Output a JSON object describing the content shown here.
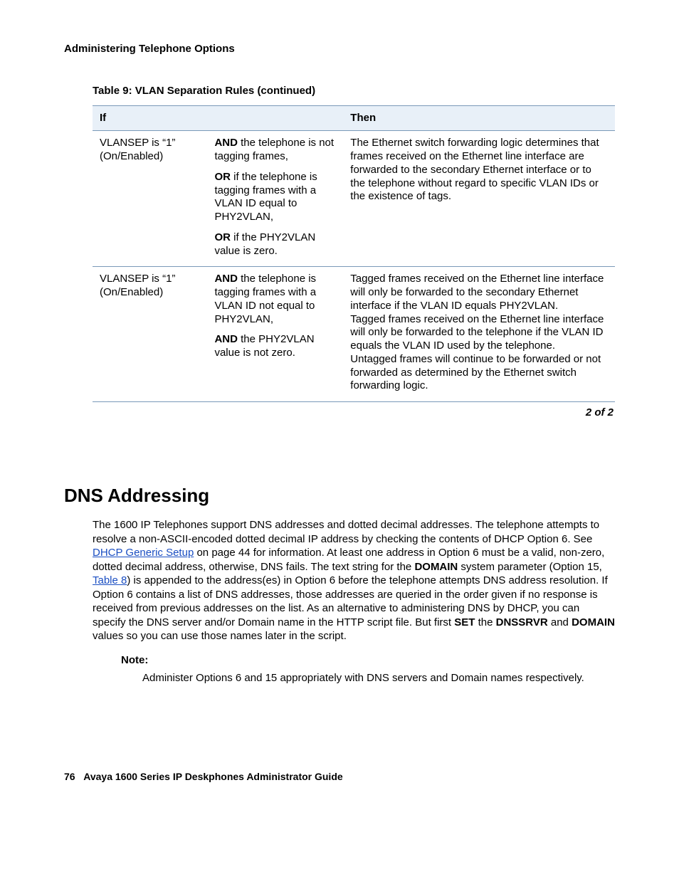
{
  "header": {
    "title": "Administering Telephone Options"
  },
  "table": {
    "caption": "Table 9: VLAN Separation Rules (continued)",
    "head_if": "If",
    "head_then": "Then",
    "rows": [
      {
        "if_text": "VLANSEP is “1” (On/Enabled)",
        "cond1_b": "AND",
        "cond1_t": " the telephone is not tagging frames,",
        "cond2_b": "OR",
        "cond2_t": " if the telephone is tagging frames with a VLAN ID equal to PHY2VLAN,",
        "cond3_b": "OR",
        "cond3_t": " if the PHY2VLAN value is zero.",
        "then": "The Ethernet switch forwarding logic determines that frames received on the Ethernet line interface are forwarded to the secondary Ethernet interface or to the telephone without regard to specific VLAN IDs or the existence of tags."
      },
      {
        "if_text": "VLANSEP is “1” (On/Enabled)",
        "cond1_b": "AND",
        "cond1_t": " the telephone is tagging frames with a VLAN ID not equal to PHY2VLAN,",
        "cond2_b": "AND",
        "cond2_t": " the PHY2VLAN value is not zero.",
        "then1": "Tagged frames received on the Ethernet line interface will only be forwarded to the secondary Ethernet interface if the VLAN ID equals PHY2VLAN.",
        "then2": "Tagged frames received on the Ethernet line interface will only be forwarded to the telephone if the VLAN ID equals the VLAN ID used by the telephone.",
        "then3": "Untagged frames will continue to be forwarded or not forwarded as determined by the Ethernet switch forwarding logic."
      }
    ],
    "pager": "2 of 2"
  },
  "section": {
    "heading": "DNS Addressing",
    "para": {
      "p1": "The 1600 IP Telephones support DNS addresses and dotted decimal addresses. The telephone attempts to resolve a non-ASCII-encoded dotted decimal IP address by checking the contents of DHCP Option 6. See ",
      "link1": "DHCP Generic Setup",
      "p2": " on page 44 for information. At least one address in Option 6 must be a valid, non-zero, dotted decimal address, otherwise, DNS fails. The text string for the ",
      "b1": "DOMAIN",
      "p3": " system parameter (Option 15, ",
      "link2": "Table 8",
      "p4": ") is appended to the address(es) in Option 6 before the telephone attempts DNS address resolution. If Option 6 contains a list of DNS addresses, those addresses are queried in the order given if no response is received from previous addresses on the list. As an alternative to administering DNS by DHCP, you can specify the DNS server and/or Domain name in the HTTP script file. But first ",
      "b2": "SET",
      "p5": " the ",
      "b3": "DNSSRVR",
      "p6": " and ",
      "b4": "DOMAIN",
      "p7": " values so you can use those names later in the script."
    },
    "note_label": "Note:",
    "note_body": "Administer Options 6 and 15 appropriately with DNS servers and Domain names respectively."
  },
  "footer": {
    "page_no": "76",
    "title": "Avaya 1600 Series IP Deskphones Administrator Guide"
  }
}
